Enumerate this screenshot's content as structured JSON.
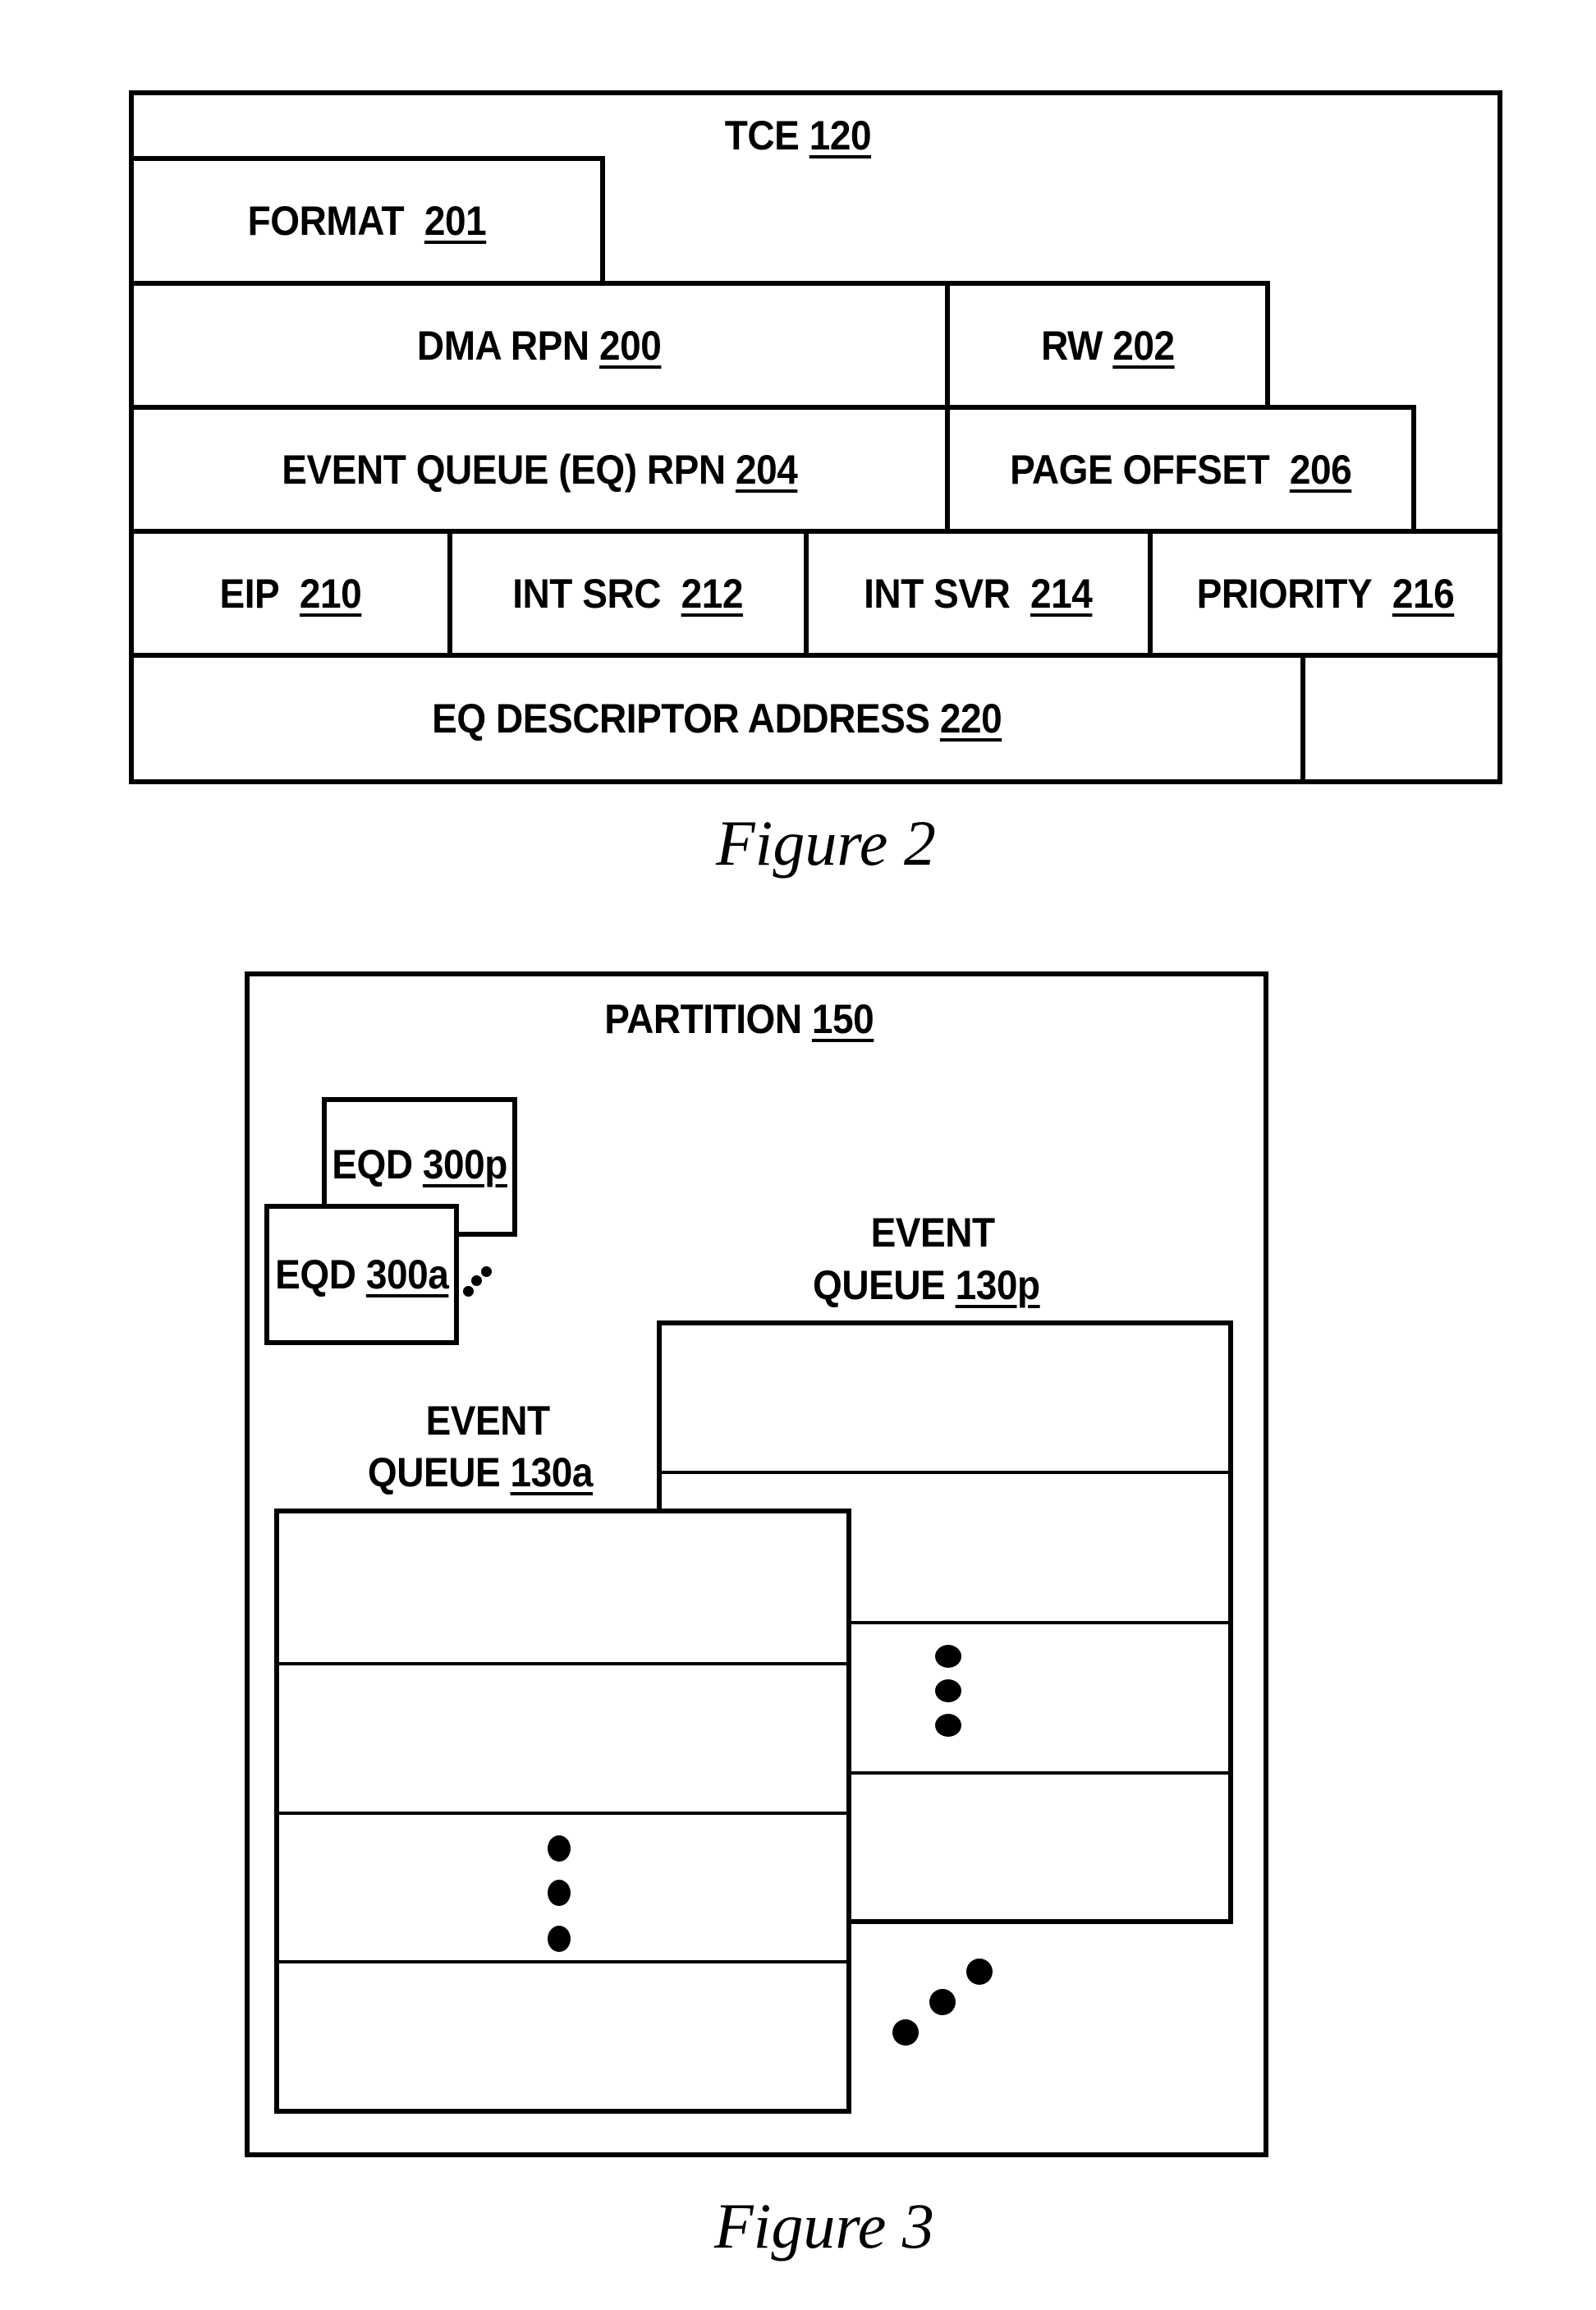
{
  "figure2": {
    "caption": "Figure 2",
    "tce": {
      "name": "TCE",
      "ref": "120"
    },
    "fields": {
      "format": {
        "name": "FORMAT",
        "ref": "201"
      },
      "dma_rpn": {
        "name": "DMA RPN",
        "ref": "200"
      },
      "rw": {
        "name": "RW",
        "ref": "202"
      },
      "eq_rpn": {
        "name": "EVENT QUEUE (EQ) RPN",
        "ref": "204"
      },
      "page_offset": {
        "name": "PAGE OFFSET",
        "ref": "206"
      },
      "eip": {
        "name": "EIP",
        "ref": "210"
      },
      "int_src": {
        "name": "INT SRC",
        "ref": "212"
      },
      "int_svr": {
        "name": "INT SVR",
        "ref": "214"
      },
      "priority": {
        "name": "PRIORITY",
        "ref": "216"
      },
      "eq_desc_addr": {
        "name": "EQ DESCRIPTOR ADDRESS",
        "ref": "220"
      }
    }
  },
  "figure3": {
    "caption": "Figure 3",
    "partition": {
      "name": "PARTITION",
      "ref": "150"
    },
    "eqd_p": {
      "name": "EQD",
      "ref": "300p"
    },
    "eqd_a": {
      "name": "EQD",
      "ref": "300a"
    },
    "event_queue_p": {
      "line1": "EVENT",
      "line2": "QUEUE",
      "ref": "130p",
      "entries": 4,
      "ellipsis_entry": 3
    },
    "event_queue_a": {
      "line1": "EVENT",
      "line2": "QUEUE",
      "ref": "130a",
      "entries": 4,
      "ellipsis_entry": 3
    }
  }
}
